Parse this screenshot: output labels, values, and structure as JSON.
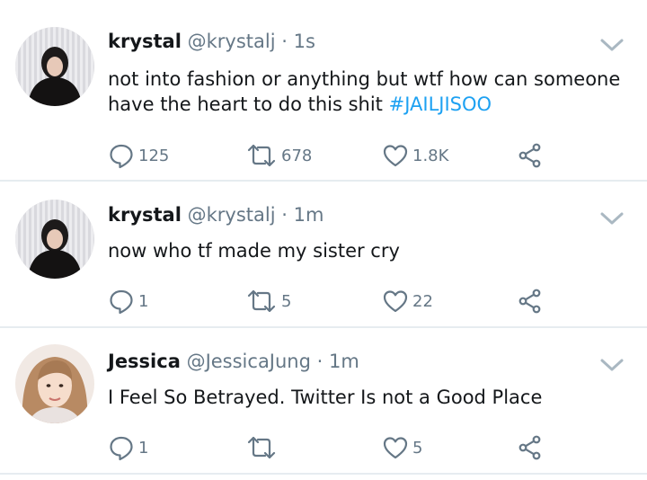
{
  "tweets": [
    {
      "name": "krystal",
      "handle": "@krystalj",
      "separator": "·",
      "time": "1s",
      "text": "not into fashion or anything but wtf how can someone have the heart to do this shit",
      "hashtag": "#JAILJISOO",
      "replies": "125",
      "retweets": "678",
      "likes": "1.8K"
    },
    {
      "name": "krystal",
      "handle": "@krystalj",
      "separator": "·",
      "time": "1m",
      "text": "now who tf made my sister cry",
      "hashtag": "",
      "replies": "1",
      "retweets": "5",
      "likes": "22"
    },
    {
      "name": "Jessica",
      "handle": "@JessicaJung",
      "separator": "·",
      "time": "1m",
      "text": "I Feel So Betrayed. Twitter Is not a Good Place",
      "hashtag": "",
      "replies": "1",
      "retweets": "",
      "likes": "5"
    }
  ],
  "colors": {
    "accent": "#1da1f2",
    "muted": "#657786",
    "divider": "#e6ecf0"
  },
  "icons": [
    "reply-icon",
    "retweet-icon",
    "like-icon",
    "share-icon",
    "chevron-down-icon"
  ]
}
